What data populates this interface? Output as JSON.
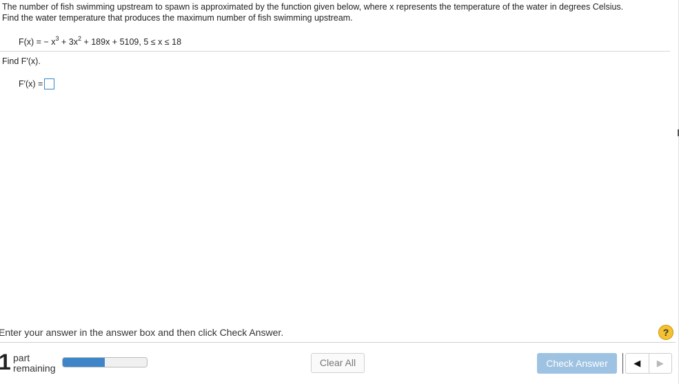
{
  "problem": {
    "line1": "The number of fish swimming upstream to spawn is approximated by the function given below, where x represents the temperature of the water in degrees Celsius.",
    "line2": "Find the water temperature that produces the maximum number of fish swimming upstream.",
    "formula": {
      "part1": "F(x) = − x",
      "exp1": "3",
      "part2": " + 3x",
      "exp2": "2",
      "part3": " + 189x + 5109, 5 ≤ x ≤ 18"
    },
    "find_label": "Find F′(x).",
    "answer_prefix": "F′(x) ="
  },
  "footer": {
    "instruction": "Enter your answer in the answer box and then click Check Answer.",
    "help": "?",
    "parts_count": "1",
    "parts_word1": "part",
    "parts_word2": "remaining",
    "progress_fraction": 0.5,
    "clear_label": "Clear All",
    "check_label": "Check Answer",
    "prev_icon": "◀",
    "next_icon": "▶"
  },
  "colors": {
    "accent": "#3f86c9",
    "check_disabled": "#9ec2e1",
    "help": "#f4c130"
  }
}
